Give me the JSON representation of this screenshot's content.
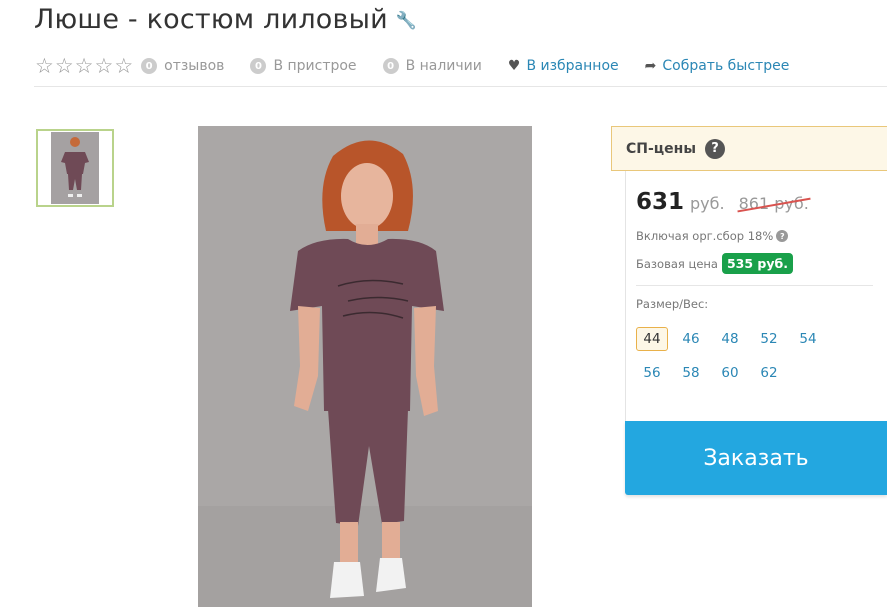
{
  "product": {
    "title": "Люше - костюм лиловый"
  },
  "meta": {
    "reviews_count": "0",
    "reviews_label": "отзывов",
    "pristroy_count": "0",
    "pristroy_label": "В пристрое",
    "stock_count": "0",
    "stock_label": "В наличии",
    "favorite_label": "В избранное",
    "collect_label": "Собрать быстрее"
  },
  "pricing": {
    "header": "СП-цены",
    "price": "631",
    "currency": "руб.",
    "old_price": "861 руб.",
    "fee_text": "Включая орг.сбор 18%",
    "base_label": "Базовая цена",
    "base_price": "535 руб.",
    "size_label": "Размер/Вес:",
    "sizes": [
      "44",
      "46",
      "48",
      "52",
      "54",
      "56",
      "58",
      "60",
      "62"
    ],
    "selected_size": "44",
    "order_label": "Заказать"
  },
  "colors": {
    "accent": "#23a7e0",
    "link": "#2b87b5",
    "badge_green": "#19a04a",
    "strike_red": "#d9534f",
    "highlight_border": "#e9b14a",
    "thumb_border": "#b9d38b",
    "outfit": "#6f4a56"
  },
  "icons": {
    "title_edit": "wrench-icon",
    "stars": "star-outline-icon",
    "favorite": "heart-icon",
    "collect": "share-arrow-icon",
    "help": "question-circle-icon"
  }
}
